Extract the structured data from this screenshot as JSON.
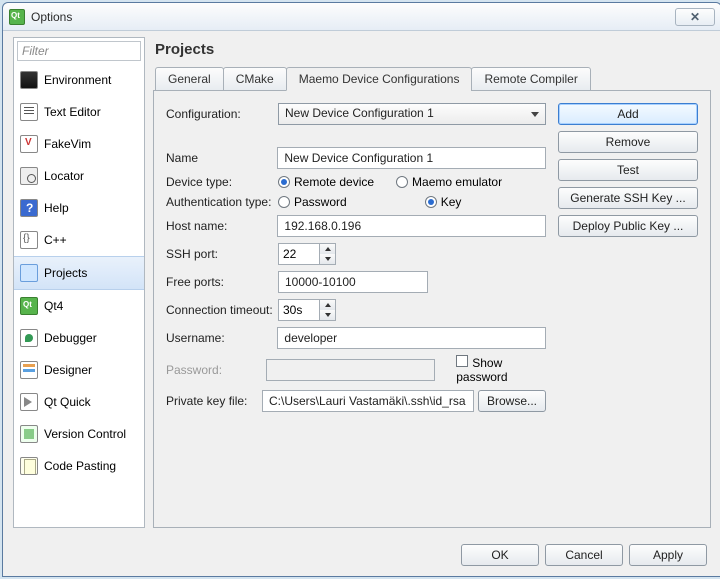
{
  "window": {
    "title": "Options",
    "close_glyph": "✕"
  },
  "sidebar": {
    "filter_placeholder": "Filter",
    "items": [
      {
        "label": "Environment",
        "selected": false,
        "icon": "ci-env"
      },
      {
        "label": "Text Editor",
        "selected": false,
        "icon": "ci-text"
      },
      {
        "label": "FakeVim",
        "selected": false,
        "icon": "ci-fakevim"
      },
      {
        "label": "Locator",
        "selected": false,
        "icon": "ci-locator"
      },
      {
        "label": "Help",
        "selected": false,
        "icon": "ci-help"
      },
      {
        "label": "C++",
        "selected": false,
        "icon": "ci-cpp"
      },
      {
        "label": "Projects",
        "selected": true,
        "icon": "ci-proj"
      },
      {
        "label": "Qt4",
        "selected": false,
        "icon": "ci-qt4"
      },
      {
        "label": "Debugger",
        "selected": false,
        "icon": "ci-dbg"
      },
      {
        "label": "Designer",
        "selected": false,
        "icon": "ci-des"
      },
      {
        "label": "Qt Quick",
        "selected": false,
        "icon": "ci-quick"
      },
      {
        "label": "Version Control",
        "selected": false,
        "icon": "ci-vcs"
      },
      {
        "label": "Code Pasting",
        "selected": false,
        "icon": "ci-paste"
      }
    ]
  },
  "main": {
    "header": "Projects",
    "tabs": [
      {
        "label": "General",
        "active": false
      },
      {
        "label": "CMake",
        "active": false
      },
      {
        "label": "Maemo Device Configurations",
        "active": true
      },
      {
        "label": "Remote Compiler",
        "active": false
      }
    ],
    "config_label": "Configuration:",
    "config_value": "New Device Configuration 1",
    "name_label": "Name",
    "name_value": "New Device Configuration 1",
    "devtype_label": "Device type:",
    "devtype_opts": {
      "remote": "Remote device",
      "emu": "Maemo emulator",
      "selected": "remote"
    },
    "auth_label": "Authentication type:",
    "auth_opts": {
      "pw": "Password",
      "key": "Key",
      "selected": "key"
    },
    "host_label": "Host name:",
    "host_value": "192.168.0.196",
    "sshport_label": "SSH port:",
    "sshport_value": "22",
    "freeports_label": "Free ports:",
    "freeports_value": "10000-10100",
    "timeout_label": "Connection timeout:",
    "timeout_value": "30s",
    "user_label": "Username:",
    "user_value": "developer",
    "pw_label": "Password:",
    "pw_value": "",
    "showpw_label": "Show password",
    "privkey_label": "Private key file:",
    "privkey_value": "C:\\Users\\Lauri Vastamäki\\.ssh\\id_rsa",
    "browse_label": "Browse...",
    "sidebuttons": {
      "add": "Add",
      "remove": "Remove",
      "test": "Test",
      "gen": "Generate SSH Key ...",
      "deploy": "Deploy Public Key ..."
    }
  },
  "footer": {
    "ok": "OK",
    "cancel": "Cancel",
    "apply": "Apply"
  }
}
